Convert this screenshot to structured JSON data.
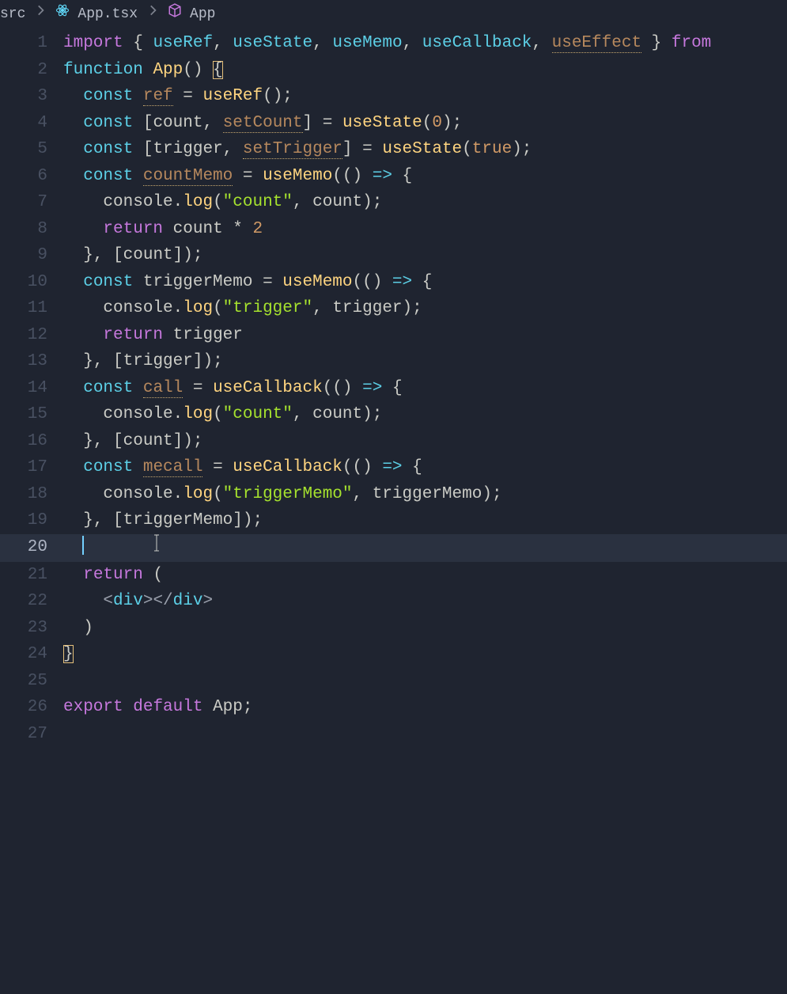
{
  "breadcrumbs": {
    "folder": "src",
    "file": "App.tsx",
    "symbol": "App"
  },
  "active_line": 20,
  "cursor_col_hint": 8,
  "lines": [
    {
      "n": 1,
      "indent": 0,
      "tokens": [
        {
          "t": "import",
          "c": "kw"
        },
        {
          "t": " "
        },
        {
          "t": "{",
          "c": "pn"
        },
        {
          "t": " "
        },
        {
          "t": "useRef",
          "c": "ty"
        },
        {
          "t": ", "
        },
        {
          "t": "useState",
          "c": "ty"
        },
        {
          "t": ", "
        },
        {
          "t": "useMemo",
          "c": "ty"
        },
        {
          "t": ", "
        },
        {
          "t": "useCallback",
          "c": "ty"
        },
        {
          "t": ", "
        },
        {
          "t": "useEffect",
          "c": "un"
        },
        {
          "t": " "
        },
        {
          "t": "}",
          "c": "pn"
        },
        {
          "t": " "
        },
        {
          "t": "from",
          "c": "kw"
        }
      ]
    },
    {
      "n": 2,
      "indent": 0,
      "tokens": [
        {
          "t": "function",
          "c": "cn"
        },
        {
          "t": " "
        },
        {
          "t": "App",
          "c": "def"
        },
        {
          "t": "() ",
          "c": "pn"
        },
        {
          "t": "{",
          "c": "pn bmatch"
        }
      ]
    },
    {
      "n": 3,
      "indent": 1,
      "tokens": [
        {
          "t": "const",
          "c": "cn"
        },
        {
          "t": " "
        },
        {
          "t": "ref",
          "c": "un"
        },
        {
          "t": " = ",
          "c": "pn"
        },
        {
          "t": "useRef",
          "c": "fn"
        },
        {
          "t": "();",
          "c": "pn"
        }
      ]
    },
    {
      "n": 4,
      "indent": 1,
      "tokens": [
        {
          "t": "const",
          "c": "cn"
        },
        {
          "t": " ["
        },
        {
          "t": "count",
          "c": "id"
        },
        {
          "t": ", "
        },
        {
          "t": "setCount",
          "c": "un"
        },
        {
          "t": "] = ",
          "c": "pn"
        },
        {
          "t": "useState",
          "c": "fn"
        },
        {
          "t": "(",
          "c": "pn"
        },
        {
          "t": "0",
          "c": "nm"
        },
        {
          "t": ");",
          "c": "pn"
        }
      ]
    },
    {
      "n": 5,
      "indent": 1,
      "tokens": [
        {
          "t": "const",
          "c": "cn"
        },
        {
          "t": " ["
        },
        {
          "t": "trigger",
          "c": "id"
        },
        {
          "t": ", "
        },
        {
          "t": "setTrigger",
          "c": "un"
        },
        {
          "t": "] = ",
          "c": "pn"
        },
        {
          "t": "useState",
          "c": "fn"
        },
        {
          "t": "(",
          "c": "pn"
        },
        {
          "t": "true",
          "c": "nm"
        },
        {
          "t": ");",
          "c": "pn"
        }
      ]
    },
    {
      "n": 6,
      "indent": 1,
      "tokens": [
        {
          "t": "const",
          "c": "cn"
        },
        {
          "t": " "
        },
        {
          "t": "countMemo",
          "c": "un"
        },
        {
          "t": " = ",
          "c": "pn"
        },
        {
          "t": "useMemo",
          "c": "fn"
        },
        {
          "t": "(() ",
          "c": "pn"
        },
        {
          "t": "=>",
          "c": "cn"
        },
        {
          "t": " {",
          "c": "pn"
        }
      ]
    },
    {
      "n": 7,
      "indent": 2,
      "tokens": [
        {
          "t": "console",
          "c": "id"
        },
        {
          "t": ".",
          "c": "pn"
        },
        {
          "t": "log",
          "c": "fn"
        },
        {
          "t": "(",
          "c": "pn"
        },
        {
          "t": "\"count\"",
          "c": "st"
        },
        {
          "t": ", "
        },
        {
          "t": "count",
          "c": "id"
        },
        {
          "t": ");",
          "c": "pn"
        }
      ]
    },
    {
      "n": 8,
      "indent": 2,
      "tokens": [
        {
          "t": "return",
          "c": "kw"
        },
        {
          "t": " "
        },
        {
          "t": "count",
          "c": "id"
        },
        {
          "t": " * ",
          "c": "pn"
        },
        {
          "t": "2",
          "c": "nm"
        }
      ]
    },
    {
      "n": 9,
      "indent": 1,
      "tokens": [
        {
          "t": "}, [",
          "c": "pn"
        },
        {
          "t": "count",
          "c": "id"
        },
        {
          "t": "]);",
          "c": "pn"
        }
      ]
    },
    {
      "n": 10,
      "indent": 1,
      "tokens": [
        {
          "t": "const",
          "c": "cn"
        },
        {
          "t": " "
        },
        {
          "t": "triggerMemo",
          "c": "id"
        },
        {
          "t": " = ",
          "c": "pn"
        },
        {
          "t": "useMemo",
          "c": "fn"
        },
        {
          "t": "(() ",
          "c": "pn"
        },
        {
          "t": "=>",
          "c": "cn"
        },
        {
          "t": " {",
          "c": "pn"
        }
      ]
    },
    {
      "n": 11,
      "indent": 2,
      "tokens": [
        {
          "t": "console",
          "c": "id"
        },
        {
          "t": ".",
          "c": "pn"
        },
        {
          "t": "log",
          "c": "fn"
        },
        {
          "t": "(",
          "c": "pn"
        },
        {
          "t": "\"trigger\"",
          "c": "st"
        },
        {
          "t": ", "
        },
        {
          "t": "trigger",
          "c": "id"
        },
        {
          "t": ");",
          "c": "pn"
        }
      ]
    },
    {
      "n": 12,
      "indent": 2,
      "tokens": [
        {
          "t": "return",
          "c": "kw"
        },
        {
          "t": " "
        },
        {
          "t": "trigger",
          "c": "id"
        }
      ]
    },
    {
      "n": 13,
      "indent": 1,
      "tokens": [
        {
          "t": "}, [",
          "c": "pn"
        },
        {
          "t": "trigger",
          "c": "id"
        },
        {
          "t": "]);",
          "c": "pn"
        }
      ]
    },
    {
      "n": 14,
      "indent": 1,
      "tokens": [
        {
          "t": "const",
          "c": "cn"
        },
        {
          "t": " "
        },
        {
          "t": "call",
          "c": "un"
        },
        {
          "t": " = ",
          "c": "pn"
        },
        {
          "t": "useCallback",
          "c": "fn"
        },
        {
          "t": "(() ",
          "c": "pn"
        },
        {
          "t": "=>",
          "c": "cn"
        },
        {
          "t": " {",
          "c": "pn"
        }
      ]
    },
    {
      "n": 15,
      "indent": 2,
      "tokens": [
        {
          "t": "console",
          "c": "id"
        },
        {
          "t": ".",
          "c": "pn"
        },
        {
          "t": "log",
          "c": "fn"
        },
        {
          "t": "(",
          "c": "pn"
        },
        {
          "t": "\"count\"",
          "c": "st"
        },
        {
          "t": ", "
        },
        {
          "t": "count",
          "c": "id"
        },
        {
          "t": ");",
          "c": "pn"
        }
      ]
    },
    {
      "n": 16,
      "indent": 1,
      "tokens": [
        {
          "t": "}, [",
          "c": "pn"
        },
        {
          "t": "count",
          "c": "id"
        },
        {
          "t": "]);",
          "c": "pn"
        }
      ]
    },
    {
      "n": 17,
      "indent": 1,
      "tokens": [
        {
          "t": "const",
          "c": "cn"
        },
        {
          "t": " "
        },
        {
          "t": "mecall",
          "c": "un"
        },
        {
          "t": " = ",
          "c": "pn"
        },
        {
          "t": "useCallback",
          "c": "fn"
        },
        {
          "t": "(() ",
          "c": "pn"
        },
        {
          "t": "=>",
          "c": "cn"
        },
        {
          "t": " {",
          "c": "pn"
        }
      ]
    },
    {
      "n": 18,
      "indent": 2,
      "tokens": [
        {
          "t": "console",
          "c": "id"
        },
        {
          "t": ".",
          "c": "pn"
        },
        {
          "t": "log",
          "c": "fn"
        },
        {
          "t": "(",
          "c": "pn"
        },
        {
          "t": "\"triggerMemo\"",
          "c": "st"
        },
        {
          "t": ", "
        },
        {
          "t": "triggerMemo",
          "c": "id"
        },
        {
          "t": ");",
          "c": "pn"
        }
      ]
    },
    {
      "n": 19,
      "indent": 1,
      "tokens": [
        {
          "t": "}, [",
          "c": "pn"
        },
        {
          "t": "triggerMemo",
          "c": "id"
        },
        {
          "t": "]);",
          "c": "pn"
        }
      ]
    },
    {
      "n": 20,
      "indent": 1,
      "tokens": []
    },
    {
      "n": 21,
      "indent": 1,
      "tokens": [
        {
          "t": "return",
          "c": "kw"
        },
        {
          "t": " (",
          "c": "pn"
        }
      ]
    },
    {
      "n": 22,
      "indent": 2,
      "tokens": [
        {
          "t": "<",
          "c": "gr"
        },
        {
          "t": "div",
          "c": "tg"
        },
        {
          "t": ">",
          "c": "gr"
        },
        {
          "t": "</",
          "c": "gr"
        },
        {
          "t": "div",
          "c": "tg"
        },
        {
          "t": ">",
          "c": "gr"
        }
      ]
    },
    {
      "n": 23,
      "indent": 1,
      "tokens": [
        {
          "t": ")",
          "c": "pn"
        }
      ]
    },
    {
      "n": 24,
      "indent": 0,
      "tokens": [
        {
          "t": "}",
          "c": "pn bmatch"
        }
      ]
    },
    {
      "n": 25,
      "indent": 0,
      "tokens": []
    },
    {
      "n": 26,
      "indent": 0,
      "tokens": [
        {
          "t": "export",
          "c": "kw"
        },
        {
          "t": " "
        },
        {
          "t": "default",
          "c": "kw"
        },
        {
          "t": " "
        },
        {
          "t": "App",
          "c": "id"
        },
        {
          "t": ";",
          "c": "pn"
        }
      ]
    },
    {
      "n": 27,
      "indent": 0,
      "tokens": []
    }
  ]
}
